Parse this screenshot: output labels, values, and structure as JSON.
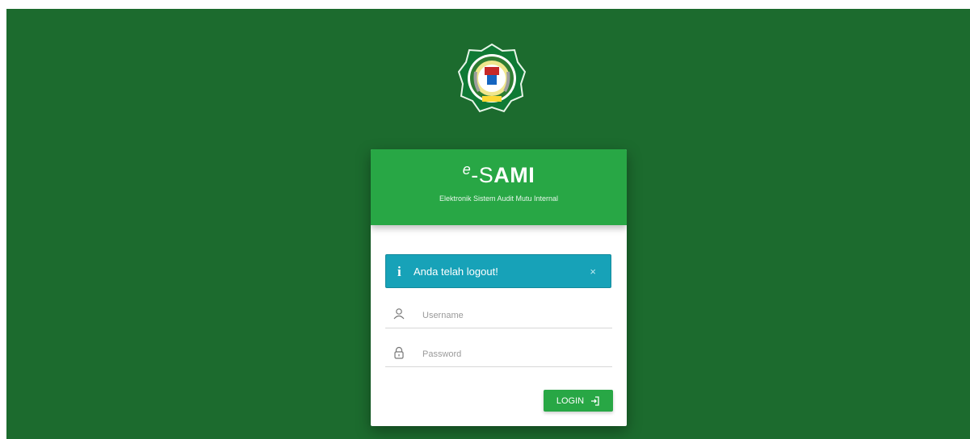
{
  "brand": {
    "prefix": "e",
    "dash": "-",
    "s": "S",
    "ami": "AMI",
    "tagline": "Elektronik Sistem Audit Mutu Internal"
  },
  "alert": {
    "icon": "info-icon",
    "message": "Anda telah logout!",
    "close": "×"
  },
  "form": {
    "username_placeholder": "Username",
    "password_placeholder": "Password",
    "login_label": "LOGIN"
  },
  "colors": {
    "background": "#1c6b2e",
    "accent": "#28a745",
    "alert": "#17a2b8"
  },
  "icons": {
    "logo": "institution-emblem-logo",
    "user": "user-icon",
    "lock": "lock-icon",
    "login": "login-icon"
  }
}
